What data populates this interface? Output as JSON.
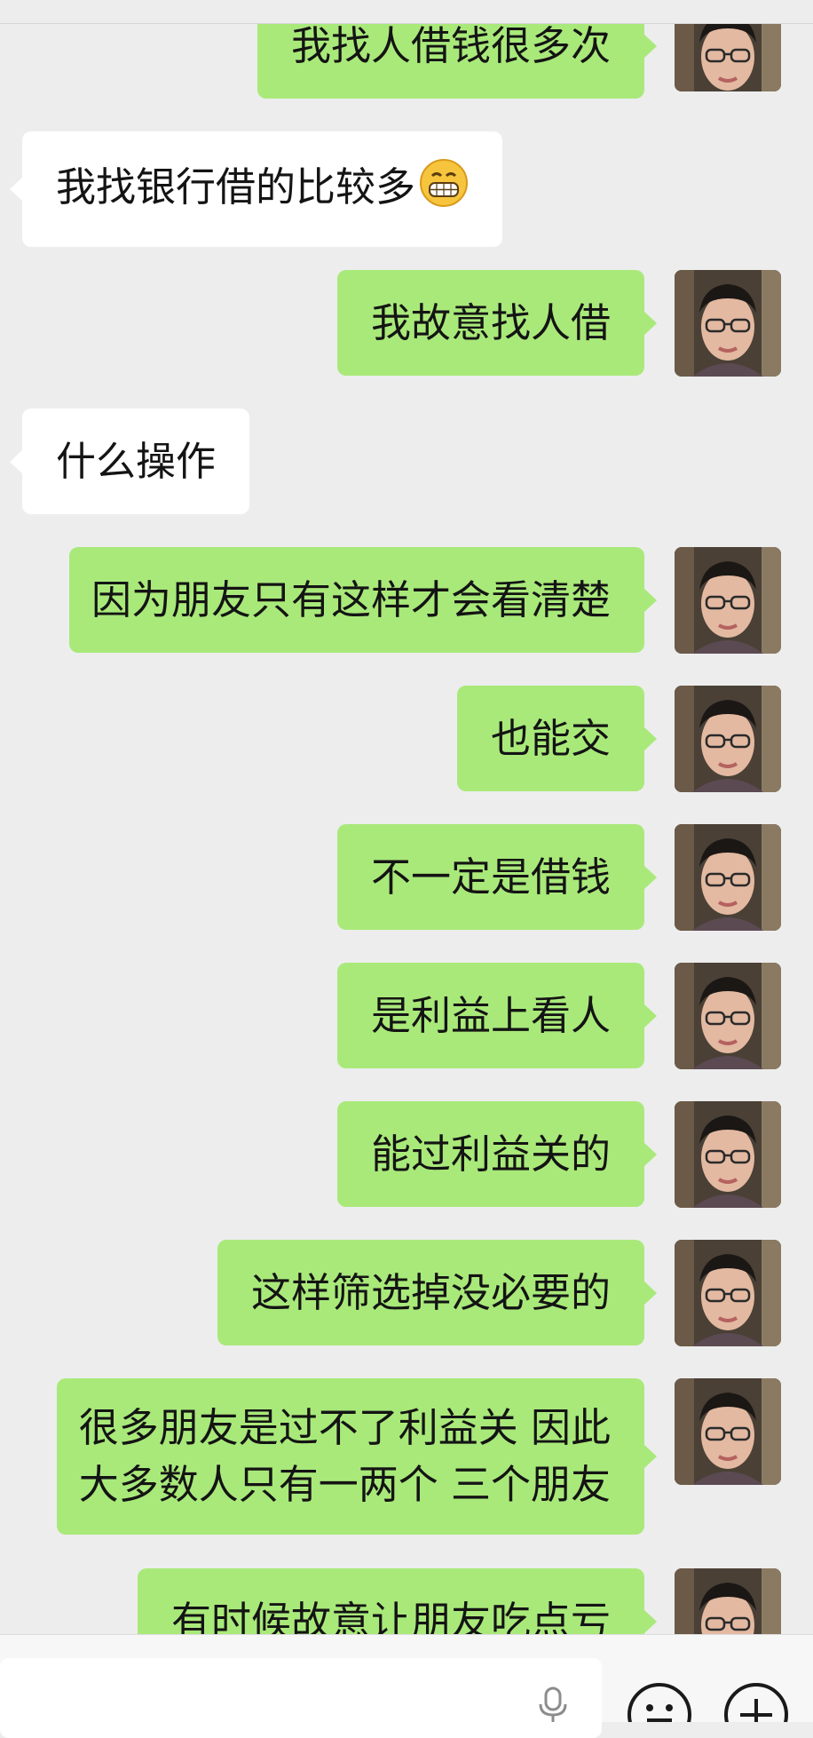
{
  "chat": {
    "messages": [
      {
        "sender": "me",
        "text": "我找人借钱很多次"
      },
      {
        "sender": "other",
        "text": "我找银行借的比较多",
        "emoji": "grinning-face"
      },
      {
        "sender": "me",
        "text": "我故意找人借"
      },
      {
        "sender": "other",
        "text": "什么操作"
      },
      {
        "sender": "me",
        "text": "因为朋友只有这样才会看清楚"
      },
      {
        "sender": "me",
        "text": "也能交"
      },
      {
        "sender": "me",
        "text": "不一定是借钱"
      },
      {
        "sender": "me",
        "text": "是利益上看人"
      },
      {
        "sender": "me",
        "text": "能过利益关的"
      },
      {
        "sender": "me",
        "text": "这样筛选掉没必要的"
      },
      {
        "sender": "me",
        "lines": [
          "很多朋友是过不了利益关 因此",
          "大多数人只有一两个 三个朋友"
        ]
      },
      {
        "sender": "me",
        "text": "有时候故意让朋友吃点亏"
      }
    ]
  },
  "input_bar": {
    "icons": [
      "microphone-icon",
      "emoji-icon",
      "plus-icon"
    ]
  },
  "colors": {
    "background": "#ededed",
    "my_bubble": "#a9e97a",
    "other_bubble": "#ffffff"
  }
}
